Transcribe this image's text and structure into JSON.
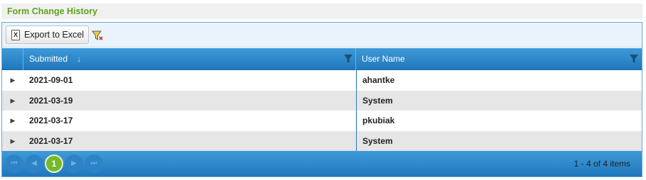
{
  "panel": {
    "title": "Form Change History"
  },
  "toolbar": {
    "export_label": "Export to Excel",
    "export_icon": "excel-icon",
    "filter_icon": "clear-filter-icon"
  },
  "columns": {
    "submitted": {
      "label": "Submitted",
      "sort": "descending"
    },
    "user": {
      "label": "User Name"
    }
  },
  "rows": [
    {
      "submitted": "2021-09-01",
      "user": "ahantke"
    },
    {
      "submitted": "2021-03-19",
      "user": "System"
    },
    {
      "submitted": "2021-03-17",
      "user": "pkubiak"
    },
    {
      "submitted": "2021-03-17",
      "user": "System"
    }
  ],
  "pager": {
    "first": "⏮",
    "prev": "◀",
    "current_page": "1",
    "next": "▶",
    "last": "⏭",
    "info": "1 - 4 of 4 items"
  },
  "colors": {
    "header_blue": "#1f78bd",
    "title_green": "#5fa31c",
    "current_page_green": "#78b82a"
  }
}
